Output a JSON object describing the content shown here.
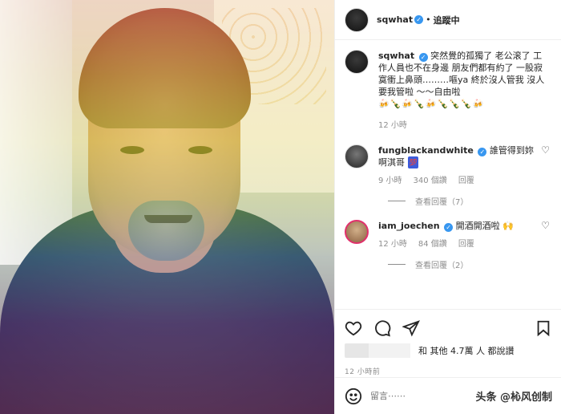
{
  "post": {
    "username": "sqwhat",
    "follow_label": "追蹤中",
    "separator": "•"
  },
  "caption": {
    "username": "sqwhat",
    "text": "突然覺的孤獨了 老公滚了 工作人員也不在身邊 朋友們都有約了 一股寂寞衝上鼻頭………嘔ya 終於沒人管我 沒人要我管啦 ～～自由啦",
    "emojis": "🍻🍾🍻🍾🍻🍾🍾🍾🍻",
    "time": "12 小時"
  },
  "comments": [
    {
      "username": "fungblackandwhite",
      "text": "誰管得到妳啊淇哥",
      "tag": "💯",
      "time": "9 小時",
      "likes": "340 個讚",
      "reply_label": "回覆",
      "view_replies": "查看回覆（7）"
    },
    {
      "username": "iam_joechen",
      "text": "開酒開酒啦",
      "emoji": "🙌",
      "time": "12 小時",
      "likes": "84 個讚",
      "reply_label": "回覆",
      "view_replies": "查看回覆（2）"
    }
  ],
  "likes": {
    "text": "和 其他 4.7萬 人 都說讚"
  },
  "posted": "12 小時前",
  "composer": {
    "placeholder": "留言⋯⋯"
  },
  "watermark": "头条 @杺风创制",
  "icons": {
    "heart": "heart-icon",
    "comment": "comment-icon",
    "share": "share-icon",
    "bookmark": "bookmark-icon",
    "emoji": "emoji-icon"
  }
}
